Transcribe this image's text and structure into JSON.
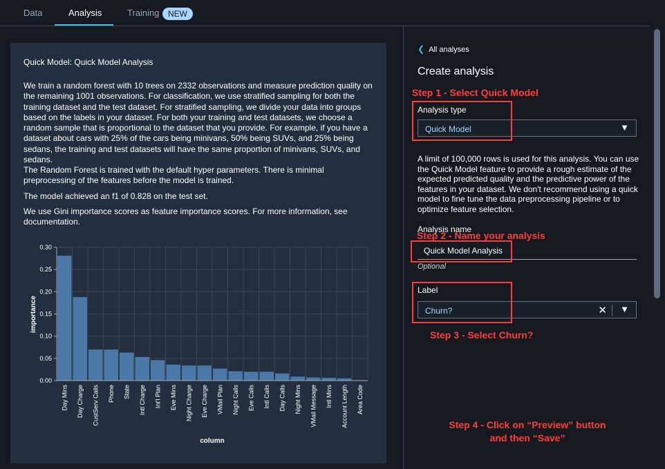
{
  "tabs": [
    {
      "label": "Data"
    },
    {
      "label": "Analysis"
    },
    {
      "label": "Training"
    }
  ],
  "tabs_badge": "NEW",
  "left": {
    "title": "Quick Model: Quick Model Analysis",
    "paragraphs": [
      "We train a random forest with 10 trees on 2332 observations and measure prediction quality on the remaining 1001 observations. For classification, we use stratified sampling for both the training dataset and the test dataset. For stratified sampling, we divide your data into groups based on the labels in your dataset. For both your training and test datasets, we choose a random sample that is proportional to the dataset that you provide. For example, if you have a dataset about cars with 25% of the cars being minivans, 50% being SUVs, and 25% being sedans, the training and test datasets will have the same proportion of minivans, SUVs, and sedans.",
      "The Random Forest is trained with the default hyper parameters. There is minimal preprocessing of the features before the model is trained.",
      "The model achieved an f1 of 0.828 on the test set.",
      "We use Gini importance scores as feature importance scores. For more information, see documentation."
    ]
  },
  "chart_data": {
    "type": "bar",
    "xlabel": "column",
    "ylabel": "importance",
    "ylim": [
      0,
      0.3
    ],
    "yticks": [
      "0.00",
      "0.05",
      "0.10",
      "0.15",
      "0.20",
      "0.25",
      "0.30"
    ],
    "categories": [
      "Day Mins",
      "Day Charge",
      "CustServ Calls",
      "Phone",
      "State",
      "Intl Charge",
      "Int'l Plan",
      "Eve Mins",
      "Night Charge",
      "Eve Charge",
      "VMail Plan",
      "Night Calls",
      "Eve Calls",
      "Intl Calls",
      "Day Calls",
      "Night Mins",
      "VMail Message",
      "Intl Mins",
      "Account Length",
      "Area Code"
    ],
    "values": [
      0.281,
      0.188,
      0.07,
      0.07,
      0.063,
      0.053,
      0.046,
      0.036,
      0.034,
      0.034,
      0.027,
      0.021,
      0.02,
      0.02,
      0.016,
      0.009,
      0.007,
      0.006,
      0.005,
      0.001
    ],
    "bar_color": "#4c78a8",
    "grid": true
  },
  "right": {
    "back_label": "All analyses",
    "heading": "Create analysis",
    "analysis_type_label": "Analysis type",
    "analysis_type_value": "Quick Model",
    "info": "A limit of 100,000 rows is used for this analysis. You can use the Quick Model feature to provide a rough estimate of the expected predicted quality and the predictive power of the features in your dataset. We don't recommend using a quick model to fine tune the data preprocessing pipeline or to optimize feature selection.",
    "analysis_name_label": "Analysis name",
    "analysis_name_value": "Quick Model Analysis",
    "optional": "Optional",
    "label_label": "Label",
    "label_value": "Churn?"
  },
  "annotations": {
    "step1": "Step 1 - Select Quick Model",
    "step2": "Step 2 - Name your analysis",
    "step3": "Step 3 - Select Churn?",
    "step4_line1": "Step 4 - Click on “Preview” button",
    "step4_line2": "and then “Save”",
    "color": "#ff3d3d"
  },
  "icons": {
    "back": "chevron-left-icon",
    "dropdown": "caret-down-icon",
    "clear": "close-icon"
  }
}
